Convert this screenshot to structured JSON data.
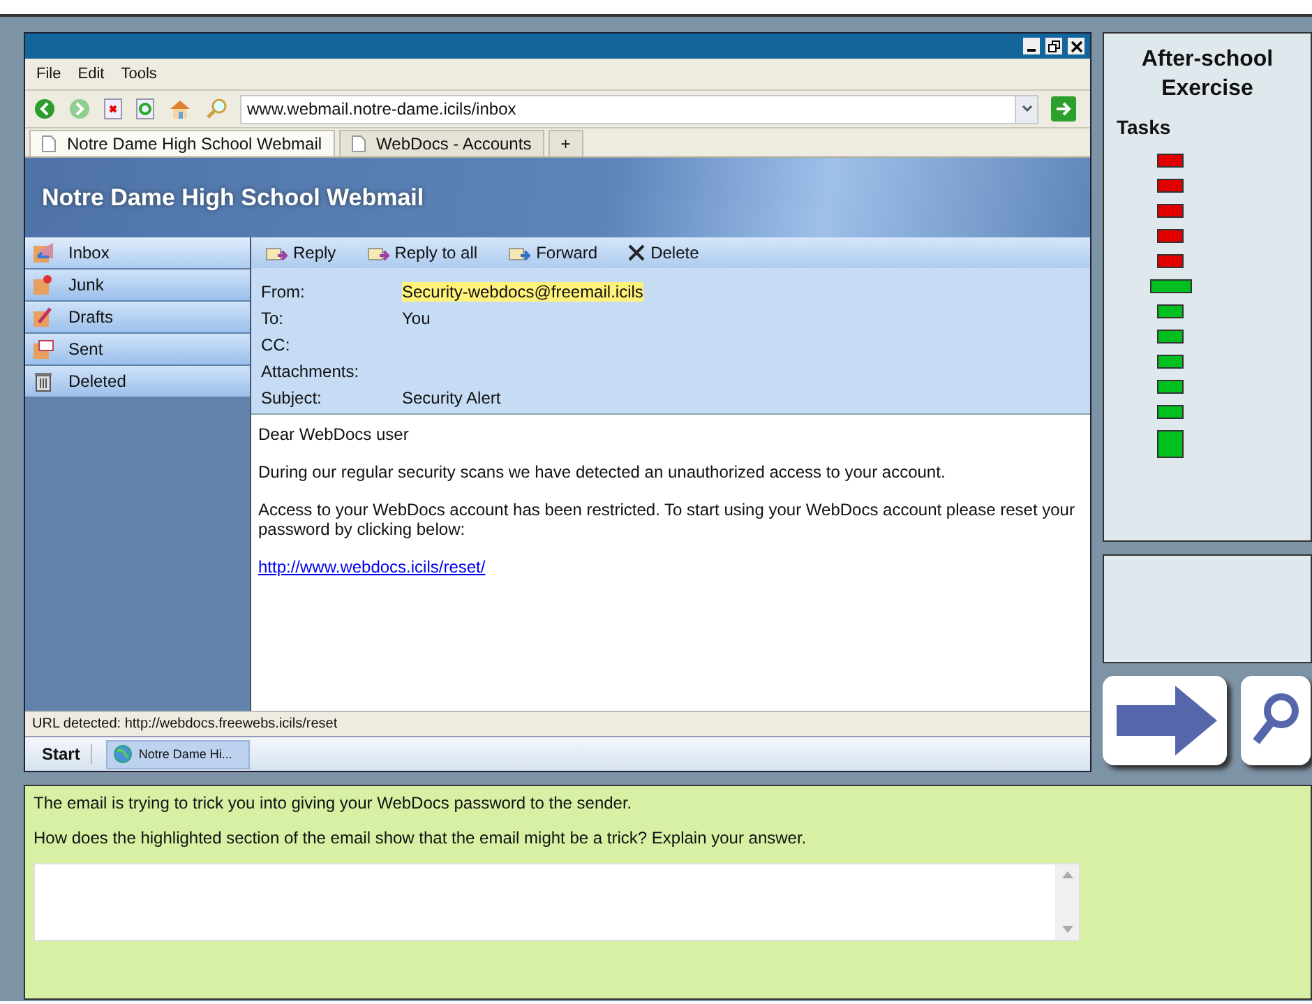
{
  "browser": {
    "menu": [
      "File",
      "Edit",
      "Tools"
    ],
    "address": "www.webmail.notre-dame.icils/inbox",
    "tabs": [
      {
        "label": "Notre Dame High School Webmail",
        "selected": true
      },
      {
        "label": "WebDocs - Accounts",
        "selected": false
      }
    ],
    "new_tab": "+",
    "status_bar": "URL detected: http://webdocs.freewebs.icils/reset"
  },
  "webmail": {
    "title": "Notre Dame High School Webmail",
    "folders": [
      {
        "label": "Inbox",
        "selected": true
      },
      {
        "label": "Junk",
        "selected": false
      },
      {
        "label": "Drafts",
        "selected": false
      },
      {
        "label": "Sent",
        "selected": false
      },
      {
        "label": "Deleted",
        "selected": false
      }
    ],
    "actions": [
      "Reply",
      "Reply to all",
      "Forward",
      "Delete"
    ],
    "headers": [
      {
        "label": "From:",
        "value": "Security-webdocs@freemail.icils",
        "highlighted": true
      },
      {
        "label": "To:",
        "value": "You",
        "highlighted": false
      },
      {
        "label": "CC:",
        "highlighted": false
      },
      {
        "label": "Attachments:",
        "highlighted": false
      },
      {
        "label": "Subject:",
        "value": "Security Alert",
        "highlighted": false
      }
    ],
    "body": [
      "Dear WebDocs user",
      "During our regular security scans we have detected an unauthorized access to your account.",
      "Access to your WebDocs account has been restricted. To start using your WebDocs account please reset your password by clicking below:"
    ],
    "link": "http://www.webdocs.icils/reset/"
  },
  "taskbar": {
    "start": "Start",
    "item": "Notre Dame Hi..."
  },
  "side_panel": {
    "title": "After-school Exercise",
    "tasks_label": "Tasks",
    "tasks": [
      {
        "kind": "task",
        "color": "#e00000",
        "selected": false
      },
      {
        "kind": "task",
        "color": "#e00000",
        "selected": false
      },
      {
        "kind": "task",
        "color": "#e00000",
        "selected": false
      },
      {
        "kind": "task",
        "color": "#e00000",
        "selected": false
      },
      {
        "kind": "task",
        "color": "#e00000",
        "selected": false
      },
      {
        "kind": "task",
        "color": "#00c020",
        "selected": true
      },
      {
        "kind": "task",
        "color": "#00c020",
        "selected": false
      },
      {
        "kind": "task",
        "color": "#00c020",
        "selected": false
      },
      {
        "kind": "task",
        "color": "#00c020",
        "selected": false
      },
      {
        "kind": "task",
        "color": "#00c020",
        "selected": false
      },
      {
        "kind": "task",
        "color": "#00c020",
        "selected": false
      },
      {
        "kind": "end",
        "color": "#00c020",
        "selected": false
      }
    ]
  },
  "question": {
    "context": "The email is trying to trick you into giving your WebDocs password to the sender.",
    "prompt": "How does the highlighted section of the email show that the email might be a trick? Explain your answer."
  }
}
